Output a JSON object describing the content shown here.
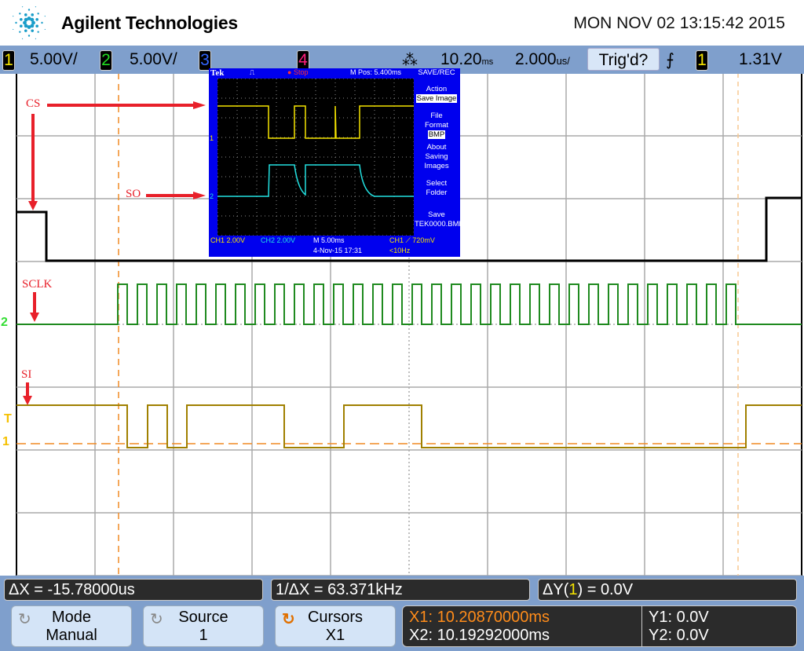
{
  "header": {
    "brand": "Agilent Technologies",
    "datetime": "MON NOV 02 13:15:42 2015"
  },
  "status": {
    "channels": [
      {
        "num": "1",
        "scale": "5.00V/",
        "color": "#f5e400"
      },
      {
        "num": "2",
        "scale": "5.00V/",
        "color": "#22dd22"
      },
      {
        "num": "3",
        "scale": "",
        "color": "#3366ff"
      },
      {
        "num": "4",
        "scale": "",
        "color": "#ff1f7a"
      }
    ],
    "delay": "10.20",
    "delay_unit": "ms",
    "timebase": "2.000",
    "timebase_unit": "us/",
    "trigger_status": "Trig'd?",
    "trigger_slope_icon": "rising-edge-icon",
    "trigger_source": "1",
    "trigger_level": "1.31V"
  },
  "annotations": {
    "cs": "CS",
    "so": "SO",
    "sclk": "SCLK",
    "si": "SI"
  },
  "markers": {
    "ch2": "2",
    "trigger": "T",
    "ch1": "1"
  },
  "tek": {
    "brand": "Tek",
    "state": "Stop",
    "mpos": "M Pos: 5.400ms",
    "menu_title": "SAVE/REC",
    "action_label": "Action",
    "action_value": "Save Image",
    "file_format_label1": "File",
    "file_format_label2": "Format",
    "file_format_value": "BMP",
    "about1": "About",
    "about2": "Saving",
    "about3": "Images",
    "select1": "Select",
    "select2": "Folder",
    "save1": "Save",
    "save2": "TEK0000.BMP",
    "ch1": "CH1  2.00V",
    "ch2": "CH2  2.00V",
    "timebase": "M 5.00ms",
    "trigger": "CH1 ⟋ 720mV",
    "date": "4-Nov-15 17:31",
    "freq": "<10Hz",
    "ch1_marker": "1",
    "ch2_marker": "2"
  },
  "measurements": {
    "dx": "ΔX = -15.78000us",
    "inv_dx": "1/ΔX = 63.371kHz",
    "dy_prefix": "ΔY(",
    "dy_src": "1",
    "dy_suffix": ") = 0.0V"
  },
  "softkeys": [
    {
      "label": "Mode",
      "value": "Manual"
    },
    {
      "label": "Source",
      "value": "1"
    },
    {
      "label": "Cursors",
      "value": "X1"
    }
  ],
  "cursors": {
    "x1": "X1: 10.20870000ms",
    "x2": "X2: 10.19292000ms",
    "y1": "Y1: 0.0V",
    "y2": "Y2: 0.0V",
    "x1_color": "#ff8c1a"
  }
}
